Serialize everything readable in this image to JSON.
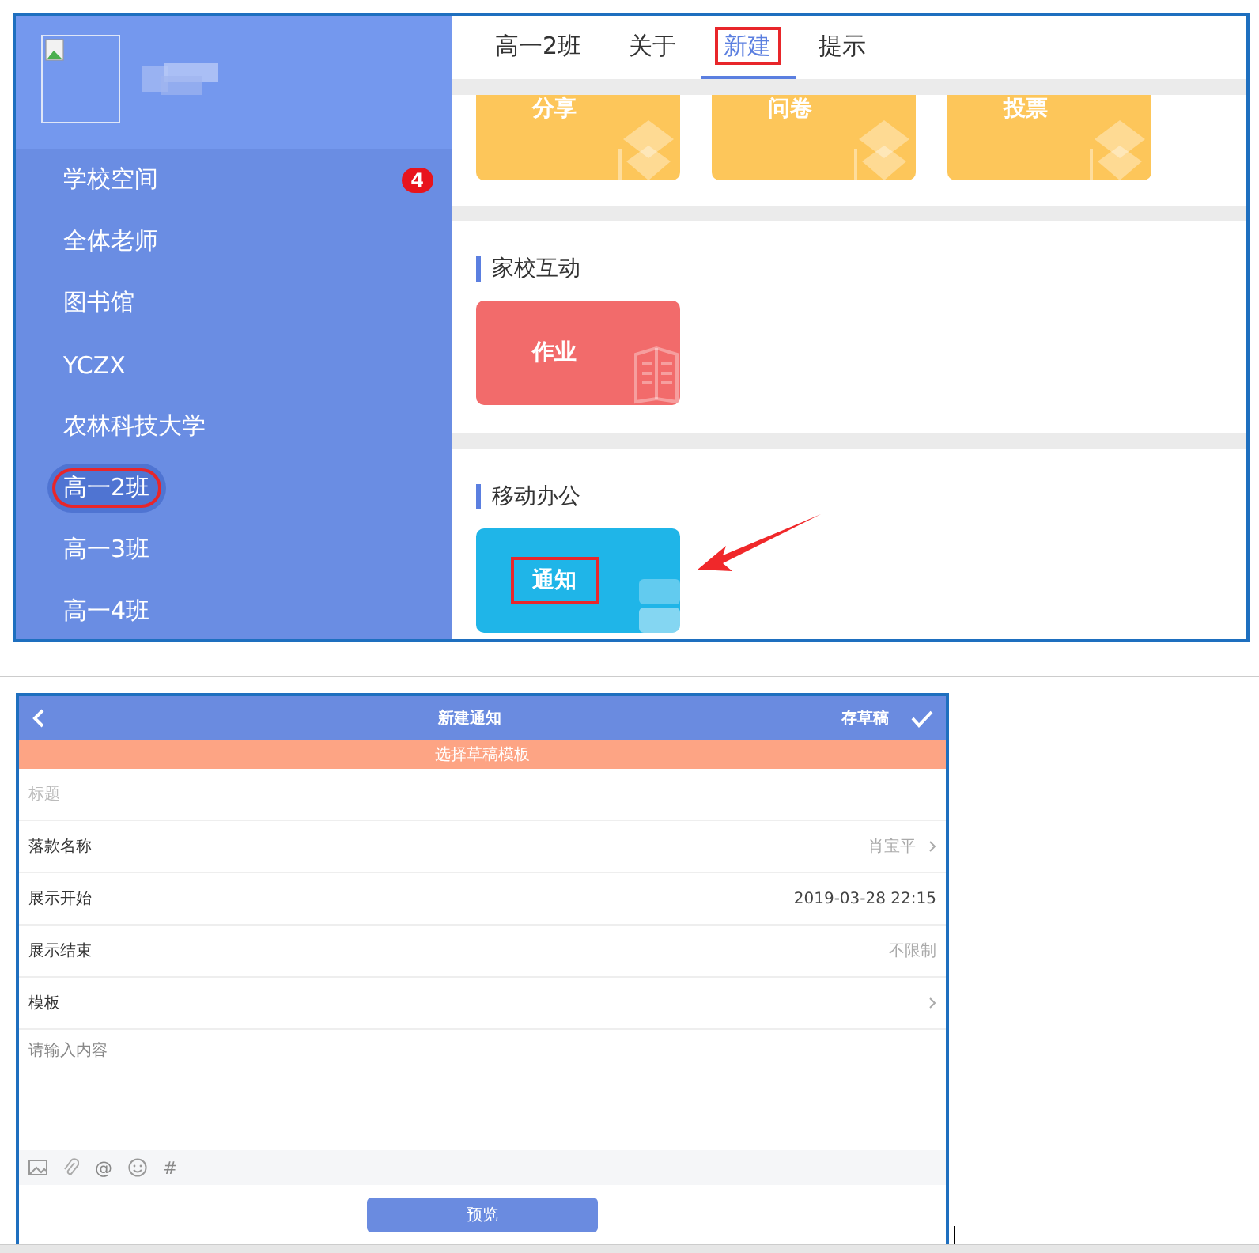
{
  "top_screen": {
    "sidebar": {
      "items": [
        {
          "label": "学校空间",
          "badge": "4",
          "selected": false,
          "highlighted": false
        },
        {
          "label": "全体老师",
          "selected": false,
          "highlighted": false
        },
        {
          "label": "图书馆",
          "selected": false,
          "highlighted": false
        },
        {
          "label": "YCZX",
          "selected": false,
          "highlighted": false
        },
        {
          "label": "农林科技大学",
          "selected": false,
          "highlighted": false
        },
        {
          "label": "高一2班",
          "selected": true,
          "highlighted": true
        },
        {
          "label": "高一3班",
          "selected": false,
          "highlighted": false
        },
        {
          "label": "高一4班",
          "selected": false,
          "highlighted": false
        }
      ]
    },
    "tabs": [
      {
        "label": "高一2班",
        "selected": false,
        "highlighted": false
      },
      {
        "label": "关于",
        "selected": false,
        "highlighted": false
      },
      {
        "label": "新建",
        "selected": true,
        "highlighted": true
      },
      {
        "label": "提示",
        "selected": false,
        "highlighted": false
      }
    ],
    "sections": [
      {
        "tiles": [
          {
            "label": "分享",
            "color": "#fdc65a",
            "kind": "stack",
            "highlighted": false
          },
          {
            "label": "问卷",
            "color": "#fdc65a",
            "kind": "stack",
            "highlighted": false
          },
          {
            "label": "投票",
            "color": "#fdc65a",
            "kind": "stack",
            "highlighted": false
          }
        ]
      },
      {
        "title": "家校互动",
        "tiles": [
          {
            "label": "作业",
            "color": "#f26b6b",
            "kind": "book",
            "highlighted": false
          }
        ]
      },
      {
        "title": "移动办公",
        "tiles": [
          {
            "label": "通知",
            "color": "#1fb5e8",
            "kind": "tray",
            "highlighted": true
          }
        ]
      }
    ]
  },
  "bottom_screen": {
    "header": {
      "title": "新建通知",
      "draft_button": "存草稿"
    },
    "template_bar": "选择草稿模板",
    "rows": [
      {
        "kind": "input",
        "placeholder": "标题"
      },
      {
        "kind": "field",
        "label": "落款名称",
        "value": "肖宝平",
        "muted": true,
        "chevron": true
      },
      {
        "kind": "field",
        "label": "展示开始",
        "value": "2019-03-28 22:15",
        "muted": false,
        "chevron": false
      },
      {
        "kind": "field",
        "label": "展示结束",
        "value": "不限制",
        "muted": true,
        "chevron": false
      },
      {
        "kind": "field",
        "label": "模板",
        "chevron": true
      }
    ],
    "content": {
      "placeholder": "请输入内容"
    },
    "toolbar": [
      {
        "kind": "image"
      },
      {
        "kind": "attach"
      },
      {
        "kind": "text",
        "label": "@"
      },
      {
        "kind": "emoji"
      },
      {
        "kind": "text",
        "label": "#"
      }
    ],
    "preview_button": "预览"
  }
}
